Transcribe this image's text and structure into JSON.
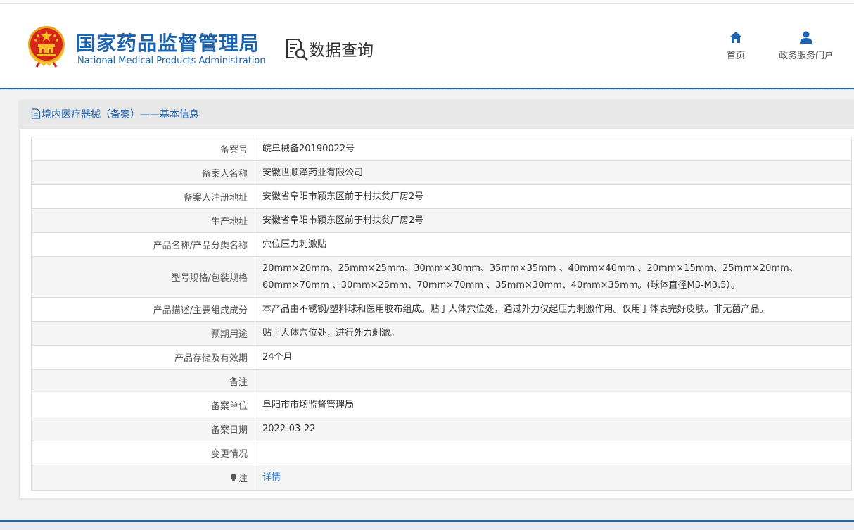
{
  "header": {
    "brand_cn": "国家药品监督管理局",
    "brand_en": "National Medical Products Administration",
    "query_label": "数据查询",
    "nav": [
      {
        "label": "首页",
        "icon": "home-icon"
      },
      {
        "label": "政务服务门户",
        "icon": "user-icon"
      }
    ]
  },
  "panel": {
    "title": "境内医疗器械（备案）——基本信息"
  },
  "table": {
    "rows": [
      {
        "label": "备案号",
        "value": "皖阜械备20190022号"
      },
      {
        "label": "备案人名称",
        "value": "安徽世顺泽药业有限公司"
      },
      {
        "label": "备案人注册地址",
        "value": "安徽省阜阳市颍东区前于村扶贫厂房2号"
      },
      {
        "label": "生产地址",
        "value": "安徽省阜阳市颍东区前于村扶贫厂房2号"
      },
      {
        "label": "产品名称/产品分类名称",
        "value": "穴位压力刺激贴"
      },
      {
        "label": "型号规格/包装规格",
        "value": "20mm×20mm、25mm×25mm、30mm×30mm、35mm×35mm 、40mm×40mm 、20mm×15mm、25mm×20mm、60mm×70mm 、30mm×25mm、70mm×70mm 、35mm×30mm、40mm×35mm。(球体直径M3-M3.5）。"
      },
      {
        "label": "产品描述/主要组成成分",
        "value": "本产品由不锈钢/塑料球和医用胶布组成。贴于人体穴位处，通过外力仅起压力刺激作用。仅用于体表完好皮肤。非无菌产品。"
      },
      {
        "label": "预期用途",
        "value": "贴于人体穴位处，进行外力刺激。"
      },
      {
        "label": "产品存储及有效期",
        "value": "24个月"
      },
      {
        "label": "备注",
        "value": ""
      },
      {
        "label": "备案单位",
        "value": "阜阳市市场监督管理局"
      },
      {
        "label": "备案日期",
        "value": "2022-03-22"
      },
      {
        "label": "变更情况",
        "value": ""
      },
      {
        "label": "注",
        "value": "详情",
        "icon": "bulb-icon"
      }
    ]
  },
  "colors": {
    "brand_blue": "#1c63b0",
    "link_blue": "#2b7fd8",
    "emblem_red": "#d6261c",
    "emblem_gold": "#f2c021"
  }
}
